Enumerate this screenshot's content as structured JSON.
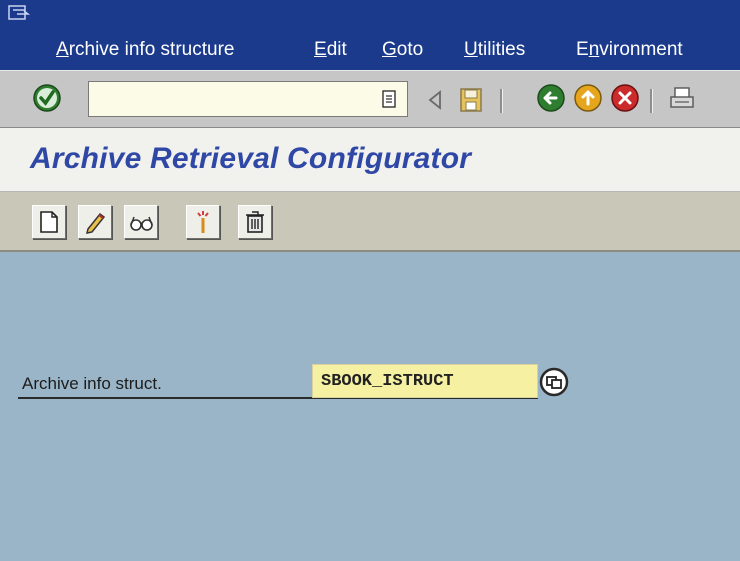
{
  "menu": {
    "items": [
      {
        "pre": "",
        "ul": "A",
        "post": "rchive info structure"
      },
      {
        "pre": "",
        "ul": "E",
        "post": "dit"
      },
      {
        "pre": "",
        "ul": "G",
        "post": "oto"
      },
      {
        "pre": "",
        "ul": "U",
        "post": "tilities"
      },
      {
        "pre": "E",
        "ul": "n",
        "post": "vironment"
      }
    ]
  },
  "toolbar": {
    "command_field": "",
    "icons": [
      "enter-icon",
      "command-history-icon",
      "back-arrow-icon",
      "save-icon",
      "back-icon",
      "exit-icon",
      "cancel-icon",
      "print-icon"
    ]
  },
  "title": {
    "text": "Archive Retrieval Configurator"
  },
  "app_toolbar": {
    "buttons": [
      "create-icon",
      "change-icon",
      "display-icon",
      "activate-icon",
      "delete-icon"
    ]
  },
  "form": {
    "label": "Archive info struct.",
    "value": "SBOOK_ISTRUCT"
  },
  "colors": {
    "menubar": "#1b3a8c",
    "title": "#2f47a5",
    "background": "#9bb5c8",
    "input_highlight": "#f5f0a2"
  }
}
